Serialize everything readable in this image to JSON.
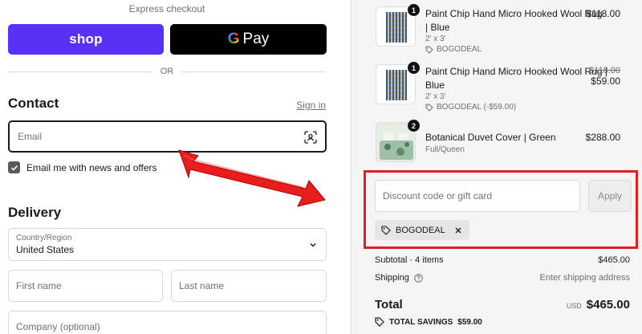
{
  "express": {
    "title": "Express checkout",
    "shop_label": "shop",
    "gpay_g": "G",
    "gpay_label": "Pay",
    "or": "OR"
  },
  "contact": {
    "heading": "Contact",
    "signin": "Sign in",
    "email_placeholder": "Email",
    "newsletter_label": "Email me with news and offers",
    "newsletter_checked": true
  },
  "delivery": {
    "heading": "Delivery",
    "country_label": "Country/Region",
    "country_value": "United States",
    "first_name_placeholder": "First name",
    "last_name_placeholder": "Last name",
    "company_placeholder": "Company (optional)"
  },
  "items": [
    {
      "qty": "1",
      "name_line1": "Paint Chip Hand Micro Hooked Wool Rug",
      "name_line2": "| Blue",
      "variant": "2' x 3'",
      "code": "BOGODEAL",
      "price": "$118.00",
      "original_price": ""
    },
    {
      "qty": "1",
      "name_line1": "Paint Chip Hand Micro Hooked Wool Rug |",
      "name_line2": "Blue",
      "variant": "2' x 3'",
      "code": "BOGODEAL (-$59.00)",
      "price": "$59.00",
      "original_price": "$118.00"
    },
    {
      "qty": "2",
      "name_line1": "Botanical Duvet Cover | Green",
      "name_line2": "",
      "variant": "Full/Queen",
      "code": "",
      "price": "$288.00",
      "original_price": ""
    }
  ],
  "discount": {
    "placeholder": "Discount code or gift card",
    "apply_label": "Apply",
    "applied_code": "BOGODEAL"
  },
  "summary": {
    "subtotal_label": "Subtotal · 4 items",
    "subtotal_value": "$465.00",
    "shipping_label": "Shipping",
    "shipping_value": "Enter shipping address",
    "total_label": "Total",
    "currency": "USD",
    "total_value": "$465.00",
    "savings_label": "TOTAL SAVINGS",
    "savings_value": "$59.00"
  },
  "colors": {
    "shop_brand": "#5a31f4",
    "annotation_red": "#e01e1e",
    "panel_bg": "#f5f5f5"
  }
}
